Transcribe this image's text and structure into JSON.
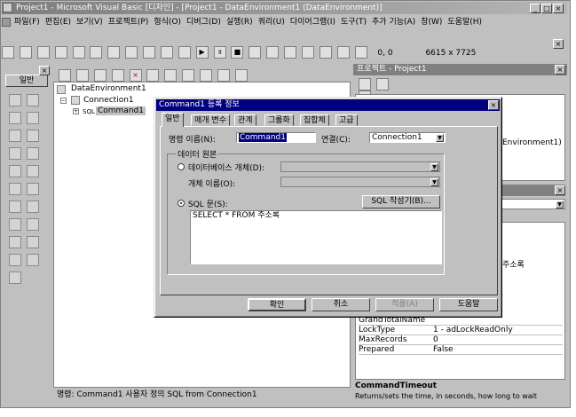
{
  "window": {
    "title": "Project1 - Microsoft Visual Basic [디자인] - [Project1 - DataEnvironment1 (DataEnvironment)]"
  },
  "menu": [
    "파일(F)",
    "편집(E)",
    "보기(V)",
    "프로젝트(P)",
    "형식(O)",
    "디버그(D)",
    "실행(R)",
    "쿼리(U)",
    "다이어그램(I)",
    "도구(T)",
    "추가 기능(A)",
    "창(W)",
    "도움말(H)"
  ],
  "toolbar": {
    "coords": "0, 0",
    "size": "6615 x 7725"
  },
  "toolbox": {
    "label": "일반"
  },
  "project_panel": {
    "title": "프로젝트 - Project1"
  },
  "tree": {
    "root": "DataEnvironment1",
    "connection": "Connection1",
    "command": "Command1",
    "sql_tag": "SQL"
  },
  "status": {
    "text": "명령:   Command1 사용자 정의 SQL from Connection1"
  },
  "right_snippets": {
    "env": "Environment1)",
    "sql_frag": "주소록"
  },
  "properties": [
    {
      "name": "GrandTotalName",
      "value": ""
    },
    {
      "name": "LockType",
      "value": "1 - adLockReadOnly"
    },
    {
      "name": "MaxRecords",
      "value": "0"
    },
    {
      "name": "Prepared",
      "value": "False"
    }
  ],
  "description": {
    "title": "CommandTimeout",
    "text": "Returns/sets the time, in seconds, how long to wait"
  },
  "dialog": {
    "title": "Command1 등록 정보",
    "tabs": [
      "일반",
      "매개 변수",
      "관계",
      "그룹화",
      "집합체",
      "고급"
    ],
    "command_name_label": "명령 이름(N):",
    "command_name": "Command1",
    "connection_label": "연결(C):",
    "connection": "Connection1",
    "source_group": "데이터 원본",
    "db_object_label": "데이터베이스 개체(D):",
    "object_name_label": "개체 이름(O):",
    "sql_label": "SQL 문(S):",
    "sql_builder": "SQL 작성기(B)...",
    "sql_text": "SELECT * FROM 주소록",
    "buttons": {
      "ok": "확인",
      "cancel": "취소",
      "apply": "적용(A)",
      "help": "도움말"
    }
  }
}
